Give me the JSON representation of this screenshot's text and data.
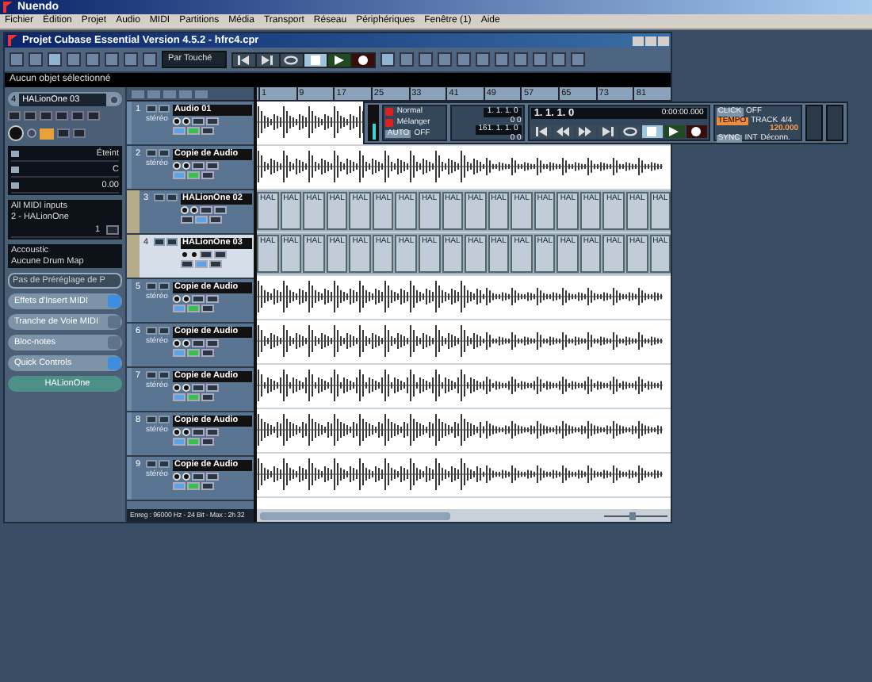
{
  "app_title": "Nuendo",
  "menu": [
    "Fichier",
    "Édition",
    "Projet",
    "Audio",
    "MIDI",
    "Partitions",
    "Média",
    "Transport",
    "Réseau",
    "Périphériques",
    "Fenêtre (1)",
    "Aide"
  ],
  "project": {
    "title": "Projet Cubase Essential Version 4.5.2 - hfrc4.cpr",
    "automation_mode": "Par Touché",
    "info": "Aucun objet sélectionné",
    "transport": [
      {
        "kind": "to-start",
        "selected": false
      },
      {
        "kind": "to-end",
        "selected": false
      },
      {
        "kind": "cycle",
        "selected": false
      },
      {
        "kind": "stop",
        "selected": true
      },
      {
        "kind": "play",
        "selected": false
      },
      {
        "kind": "record",
        "selected": false
      }
    ]
  },
  "inspector": {
    "track_number": "4",
    "track_name": "HALionOne 03",
    "readouts": [
      "Éteint",
      "C",
      "0.00"
    ],
    "midi_input": "All MIDI inputs",
    "midi_output": "2 - HALionOne",
    "channel": "1",
    "program": "Accoustic",
    "drum_map": "Aucune Drum Map",
    "preset": "Pas de Préréglage de P",
    "sections": [
      {
        "label": "Effets d'Insert MIDI",
        "active": true
      },
      {
        "label": "Tranche de Voie MIDI",
        "active": false
      },
      {
        "label": "Bloc-notes",
        "active": false
      },
      {
        "label": "Quick Controls",
        "active": true
      }
    ],
    "instrument": "HALionOne"
  },
  "tracks": [
    {
      "number": "1",
      "name": "Audio 01",
      "kind": "audio",
      "selected": false,
      "format": "stéréo"
    },
    {
      "number": "2",
      "name": "Copie de Audio",
      "kind": "audio",
      "selected": false,
      "format": "stéréo"
    },
    {
      "number": "3",
      "name": "HALionOne 02",
      "kind": "instrument",
      "selected": false,
      "parts": [
        "HAL",
        "HAL",
        "HAL",
        "HAL",
        "HAL",
        "HAL",
        "HAL",
        "HAL",
        "HAL",
        "HAL",
        "HAL",
        "HAL",
        "HAL",
        "HAL",
        "HAL",
        "HAL",
        "HAL",
        "HAL"
      ]
    },
    {
      "number": "4",
      "name": "HALionOne 03",
      "kind": "instrument",
      "selected": true,
      "parts": [
        "HAL",
        "HAL",
        "HAL",
        "HAL",
        "HAL",
        "HAL",
        "HAL",
        "HAL",
        "HAL",
        "HAL",
        "HAL",
        "HAL",
        "HAL",
        "HAL",
        "HAL",
        "HAL",
        "HAL",
        "HAL"
      ]
    },
    {
      "number": "5",
      "name": "Copie de Audio",
      "kind": "audio",
      "selected": false,
      "format": "stéréo"
    },
    {
      "number": "6",
      "name": "Copie de Audio",
      "kind": "audio",
      "selected": false,
      "format": "stéréo"
    },
    {
      "number": "7",
      "name": "Copie de Audio",
      "kind": "audio",
      "selected": false,
      "format": "stéréo"
    },
    {
      "number": "8",
      "name": "Copie de Audio",
      "kind": "audio",
      "selected": false,
      "format": "stéréo"
    },
    {
      "number": "9",
      "name": "Copie de Audio",
      "kind": "audio",
      "selected": false,
      "format": "stéréo"
    }
  ],
  "ruler": [
    "1",
    "9",
    "17",
    "25",
    "33",
    "41",
    "49",
    "57",
    "65",
    "73",
    "81"
  ],
  "status_bar": "Enreg : 96000 Hz - 24 Bit - Max : 2h 32",
  "zoom": {
    "level": 0.45
  },
  "transport": {
    "record_mode": "Normal",
    "cycle_mode": "Mélanger",
    "auto_label": "AUTO",
    "auto_state": "OFF",
    "left_locator": "1. 1. 1.   0",
    "left_offset": "0   0",
    "right_locator": "161. 1. 1.   0",
    "right_offset": "0   0",
    "position": "1. 1. 1.   0",
    "time": "0:00:00.000",
    "buttons": [
      {
        "kind": "to-start",
        "selected": false
      },
      {
        "kind": "rewind",
        "selected": false
      },
      {
        "kind": "forward",
        "selected": false
      },
      {
        "kind": "to-end",
        "selected": false
      },
      {
        "kind": "cycle",
        "selected": false
      },
      {
        "kind": "stop",
        "selected": true
      },
      {
        "kind": "play",
        "selected": false
      },
      {
        "kind": "record",
        "selected": false
      }
    ],
    "click_label": "CLICK",
    "click": "OFF",
    "tempo_label": "TEMPO",
    "tempo_mode": "TRACK",
    "signature": "4/4",
    "tempo": "120.000",
    "sync_label": "SYNC",
    "sync_source": "INT",
    "sync_state": "Déconn."
  }
}
